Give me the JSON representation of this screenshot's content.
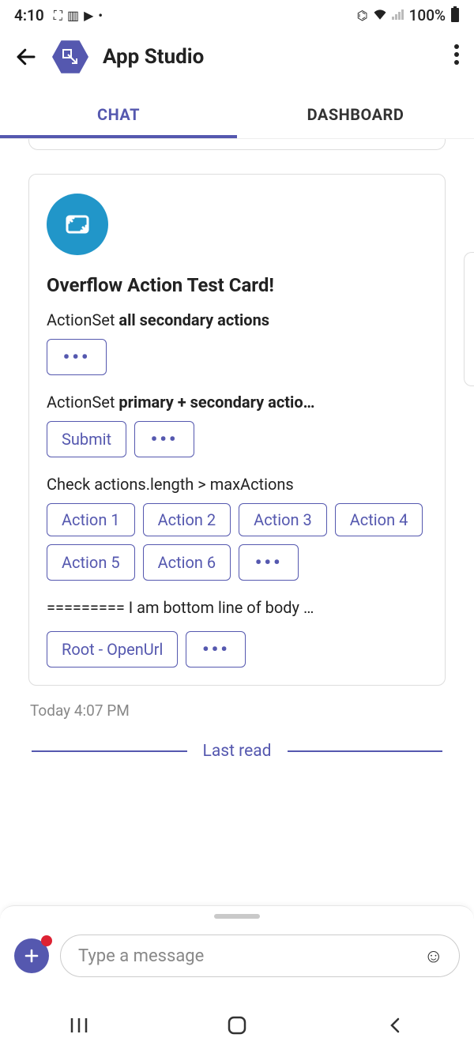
{
  "status": {
    "time": "4:10",
    "battery": "100%"
  },
  "header": {
    "title": "App Studio"
  },
  "tabs": {
    "chat": "CHAT",
    "dashboard": "DASHBOARD"
  },
  "card": {
    "title": "Overflow Action Test Card!",
    "section1_prefix": "ActionSet ",
    "section1_bold": "all secondary actions",
    "section2_prefix": "ActionSet ",
    "section2_bold": "primary + secondary actio…",
    "submit": "Submit",
    "section3": "Check actions.length > maxActions",
    "actions": [
      "Action 1",
      "Action 2",
      "Action 3",
      "Action 4",
      "Action 5",
      "Action 6"
    ],
    "bottom_line": "========= I am bottom line of body …",
    "root_open": "Root - OpenUrl",
    "dots": "•••"
  },
  "timestamp": "Today 4:07 PM",
  "last_read": "Last read",
  "compose": {
    "placeholder": "Type a message"
  }
}
